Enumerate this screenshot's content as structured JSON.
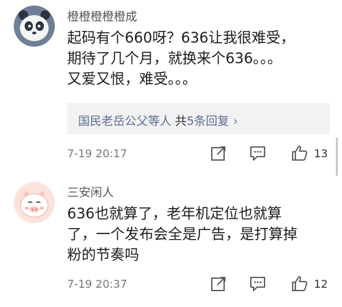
{
  "comments": [
    {
      "username": "橙橙橙橙橙成",
      "lines": [
        "起码有个660呀？636让我很难受，",
        "期待了几个月，就换来个636。。。",
        "又爱又恨，难受。。。"
      ],
      "reply": {
        "users": "国民老岳公父等人",
        "mid": " 共",
        "count": "5条回复",
        "chevron": "›"
      },
      "timestamp": "7-19 20:17",
      "likes": "13",
      "avatar_icon": "panda-avatar-icon"
    },
    {
      "username": "三安闲人",
      "lines": [
        "636也就算了，老年机定位也就算",
        "了，一个发布会全是广告，是打算掉",
        "粉的节奏吗"
      ],
      "timestamp": "7-19 20:37",
      "likes": "12",
      "avatar_icon": "pig-avatar-icon"
    }
  ],
  "icons": [
    "share-icon",
    "comment-icon",
    "like-icon"
  ],
  "colors": {
    "link": "#5b6d96",
    "reply_bg": "#f2f2f2",
    "text": "#1c1c1c",
    "muted": "#777777"
  }
}
